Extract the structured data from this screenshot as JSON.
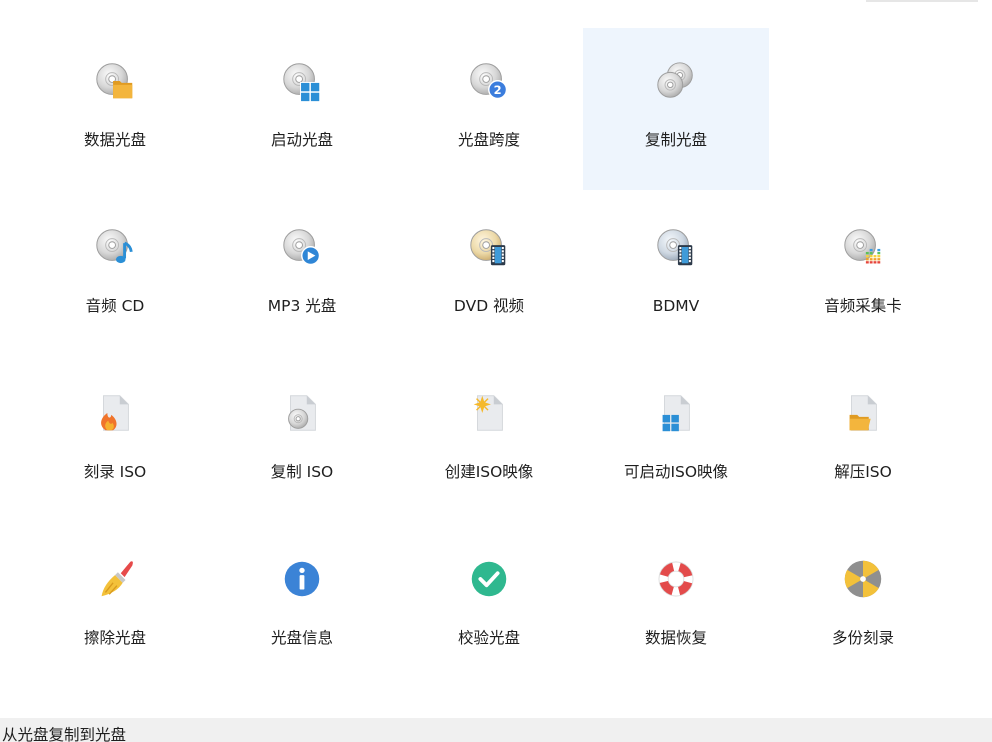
{
  "tiles": [
    {
      "label": "数据光盘",
      "icon": "disc-folder-icon",
      "selected": false
    },
    {
      "label": "启动光盘",
      "icon": "disc-windows-icon",
      "selected": false
    },
    {
      "label": "光盘跨度",
      "icon": "disc-span-icon",
      "badge": "2",
      "selected": false
    },
    {
      "label": "复制光盘",
      "icon": "disc-copy-icon",
      "selected": true
    },
    {
      "label": "",
      "icon": "",
      "selected": false
    },
    {
      "label": "音频 CD",
      "icon": "disc-music-icon",
      "selected": false
    },
    {
      "label": "MP3 光盘",
      "icon": "disc-play-icon",
      "selected": false
    },
    {
      "label": "DVD 视频",
      "icon": "dvd-film-icon",
      "selected": false
    },
    {
      "label": "BDMV",
      "icon": "bluray-film-icon",
      "selected": false
    },
    {
      "label": "音频采集卡",
      "icon": "disc-equalizer-icon",
      "selected": false
    },
    {
      "label": "刻录 ISO",
      "icon": "iso-burn-icon",
      "selected": false
    },
    {
      "label": "复制 ISO",
      "icon": "iso-copy-icon",
      "selected": false
    },
    {
      "label": "创建ISO映像",
      "icon": "iso-create-icon",
      "selected": false
    },
    {
      "label": "可启动ISO映像",
      "icon": "iso-bootable-icon",
      "selected": false
    },
    {
      "label": "解压ISO",
      "icon": "iso-extract-icon",
      "selected": false
    },
    {
      "label": "擦除光盘",
      "icon": "erase-brush-icon",
      "selected": false
    },
    {
      "label": "光盘信息",
      "icon": "info-icon",
      "selected": false
    },
    {
      "label": "校验光盘",
      "icon": "verify-check-icon",
      "selected": false
    },
    {
      "label": "数据恢复",
      "icon": "lifebuoy-icon",
      "selected": false
    },
    {
      "label": "多份刻录",
      "icon": "multi-burn-icon",
      "selected": false
    }
  ],
  "colors": {
    "selected_bg": "#eef5fd",
    "folder": "#f3b53d",
    "windows_blue": "#2b8fd6",
    "badge_blue": "#3b7ddd",
    "check_green": "#2fb88f",
    "lifebuoy_red": "#e34b4b",
    "burn_gold": "#f3c13a"
  },
  "status_bar": {
    "text": "从光盘复制到光盘"
  }
}
